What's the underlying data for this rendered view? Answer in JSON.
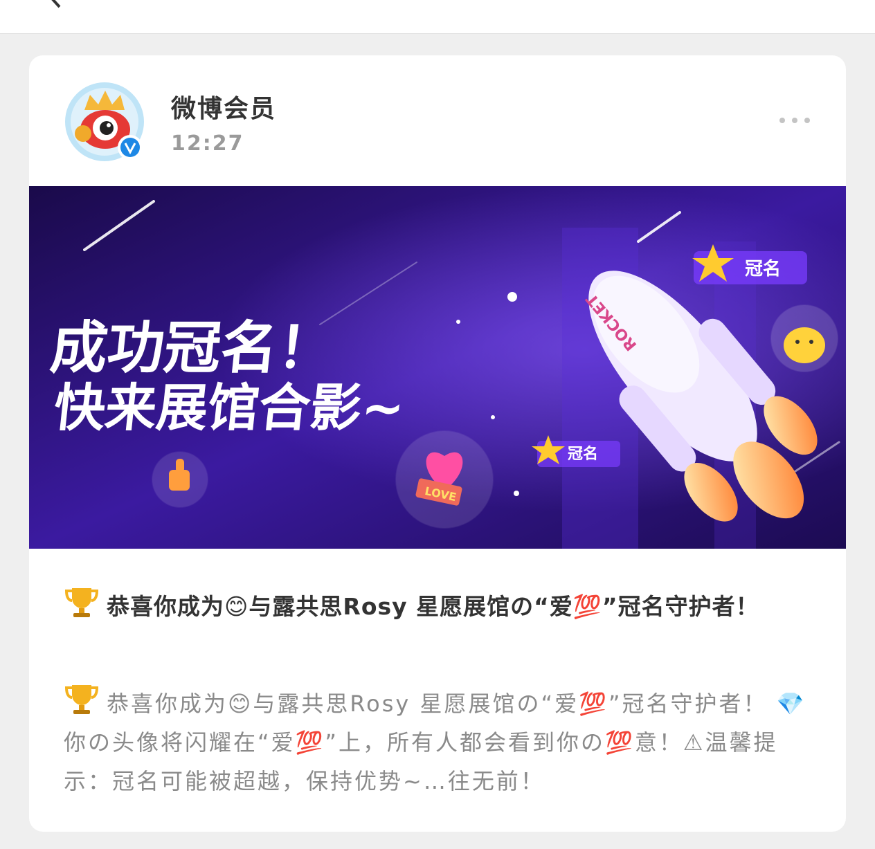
{
  "post": {
    "author": "微博会员",
    "time": "12:27",
    "headline": "恭喜你成为😊与露共思Rosy 星愿展馆の“爱💯”冠名守护者！",
    "body": "恭喜你成为😊与露共思Rosy 星愿展馆の“爱💯”冠名守护者！ 💎 你の头像将闪耀在“爱💯”上，所有人都会看到你の💯意！⚠温馨提示：冠名可能被超越，保持优势~…往无前！"
  },
  "banner": {
    "title_line1": "成功冠名！",
    "title_line2": "快来展馆合影~",
    "rocket_label": "ROCKET",
    "tag_top": "冠名",
    "tag_bottom": "冠名",
    "love_label": "LOVE"
  },
  "colors": {
    "banner_bg": "#2a0f6e",
    "accent_purple": "#7a3cff",
    "verified_blue": "#1e88e5"
  },
  "icons": {
    "trophy": "trophy-icon",
    "verified": "verified-icon",
    "more": "more-icon",
    "back": "back-icon"
  }
}
